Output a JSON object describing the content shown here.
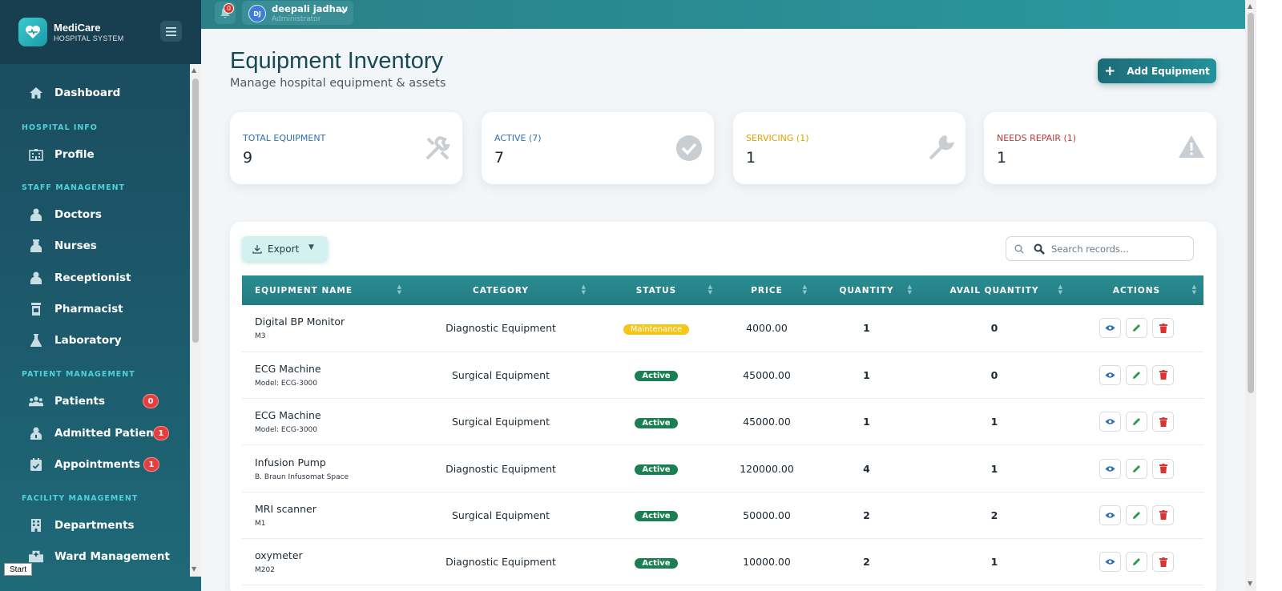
{
  "brand": {
    "name": "MediCare",
    "subtitle": "HOSPITAL SYSTEM"
  },
  "topbar": {
    "notification_count": "0",
    "user_initials": "DJ",
    "user_name": "deepali jadhav",
    "user_role": "Administrator"
  },
  "sidebar": {
    "dashboard": "Dashboard",
    "sections": {
      "hospital_info": "HOSPITAL INFO",
      "staff_management": "STAFF MANAGEMENT",
      "patient_management": "PATIENT MANAGEMENT",
      "facility_management": "FACILITY MANAGEMENT"
    },
    "items": {
      "profile": "Profile",
      "doctors": "Doctors",
      "nurses": "Nurses",
      "receptionist": "Receptionist",
      "pharmacist": "Pharmacist",
      "laboratory": "Laboratory",
      "patients": "Patients",
      "admitted_patients": "Admitted Patients",
      "appointments": "Appointments",
      "departments": "Departments",
      "ward_management": "Ward Management"
    },
    "badges": {
      "patients": "0",
      "admitted_patients": "1",
      "appointments": "1"
    }
  },
  "taskbar": {
    "start": "Start"
  },
  "page": {
    "title": "Equipment Inventory",
    "subtitle": "Manage hospital equipment & assets",
    "add_button": "Add Equipment"
  },
  "stats": [
    {
      "label": "TOTAL EQUIPMENT",
      "value": "9",
      "color": "#2e6fb7",
      "icon": "tools-icon"
    },
    {
      "label": "ACTIVE (7)",
      "value": "7",
      "color": "#2e6fb7",
      "icon": "check-circle-icon"
    },
    {
      "label": "SERVICING (1)",
      "value": "1",
      "color": "#e0a100",
      "icon": "wrench-icon"
    },
    {
      "label": "NEEDS REPAIR (1)",
      "value": "1",
      "color": "#b83a3a",
      "icon": "warning-icon"
    }
  ],
  "toolbar": {
    "export_label": "Export",
    "search_placeholder": "Search records..."
  },
  "table": {
    "headers": [
      "EQUIPMENT NAME",
      "CATEGORY",
      "STATUS",
      "PRICE",
      "QUANTITY",
      "AVAIL QUANTITY",
      "ACTIONS"
    ],
    "rows": [
      {
        "name": "Digital BP Monitor",
        "model": "M3",
        "category": "Diagnostic Equipment",
        "status": "Maintenance",
        "price": "4000.00",
        "quantity": "1",
        "avail": "0"
      },
      {
        "name": "ECG Machine",
        "model": "Model: ECG-3000",
        "category": "Surgical Equipment",
        "status": "Active",
        "price": "45000.00",
        "quantity": "1",
        "avail": "0"
      },
      {
        "name": "ECG Machine",
        "model": "Model: ECG-3000",
        "category": "Surgical Equipment",
        "status": "Active",
        "price": "45000.00",
        "quantity": "1",
        "avail": "1"
      },
      {
        "name": "Infusion Pump",
        "model": "B. Braun Infusomat Space",
        "category": "Diagnostic Equipment",
        "status": "Active",
        "price": "120000.00",
        "quantity": "4",
        "avail": "1"
      },
      {
        "name": "MRI scanner",
        "model": "M1",
        "category": "Surgical Equipment",
        "status": "Active",
        "price": "50000.00",
        "quantity": "2",
        "avail": "2"
      },
      {
        "name": "oxymeter",
        "model": "M202",
        "category": "Diagnostic Equipment",
        "status": "Active",
        "price": "10000.00",
        "quantity": "2",
        "avail": "1"
      }
    ]
  },
  "colors": {
    "accent": "#24929a",
    "active": "#1a7f52",
    "maintenance": "#f5c518",
    "danger": "#d93434",
    "view": "#2e6fb7",
    "edit": "#2a9a4a"
  }
}
